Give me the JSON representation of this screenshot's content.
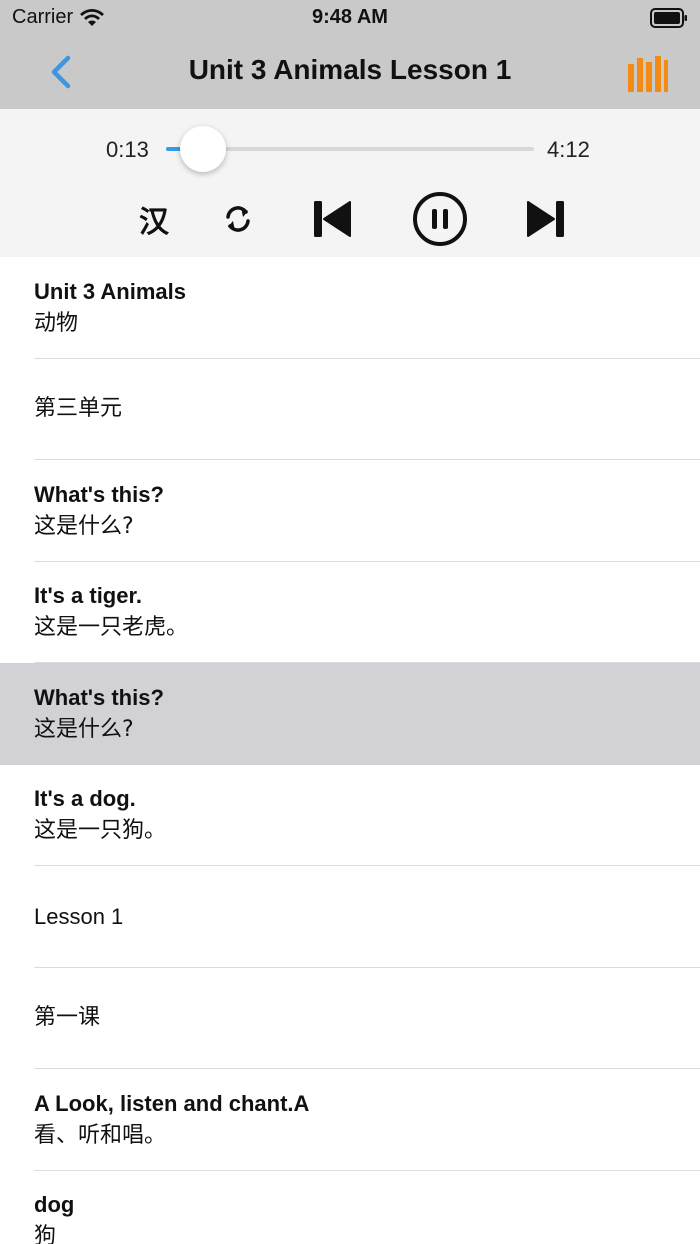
{
  "status": {
    "carrier": "Carrier",
    "time": "9:48 AM"
  },
  "nav": {
    "title": "Unit 3 Animals Lesson 1",
    "back_icon": "chevron-left-icon",
    "menu_icon": "bars-icon",
    "accent": "#3d96e0",
    "orange": "#f28a13"
  },
  "player": {
    "current_time": "0:13",
    "total_time": "4:12",
    "progress": 0.052,
    "han_label": "汉",
    "state": "playing"
  },
  "rows": [
    {
      "en": "Unit 3 Animals",
      "zh": "动物",
      "selected": false
    },
    {
      "en": "",
      "zh": "第三单元",
      "selected": false
    },
    {
      "en": "What's this?",
      "zh": "这是什么?",
      "selected": false
    },
    {
      "en": "It's a tiger.",
      "zh": "这是一只老虎。",
      "selected": false
    },
    {
      "en": "What's this?",
      "zh": "这是什么?",
      "selected": true
    },
    {
      "en": "It's a dog.",
      "zh": "这是一只狗。",
      "selected": false
    },
    {
      "en": "Lesson 1",
      "zh": "",
      "selected": false
    },
    {
      "en": "",
      "zh": "第一课",
      "selected": false
    },
    {
      "en": "A Look, listen and chant.A",
      "zh": "看、听和唱。",
      "selected": false
    },
    {
      "en": "dog",
      "zh": "狗",
      "selected": false
    }
  ]
}
